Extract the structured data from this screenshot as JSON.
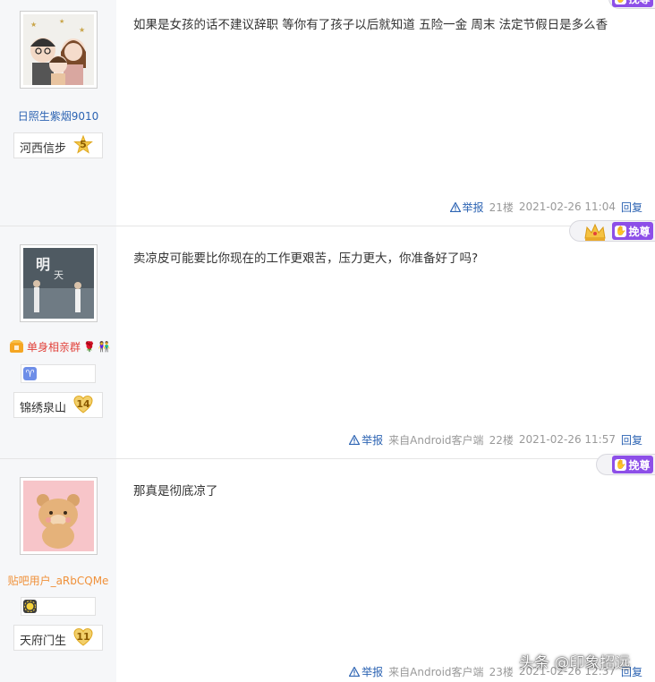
{
  "posts": [
    {
      "username": "日照生紫烟9010",
      "forum_name": "河西信步",
      "level": "5",
      "content": "如果是女孩的话不建议辞职 等你有了孩子以后就知道 五险一金 周末 法定节假日是多么香",
      "report_label": "举报",
      "floor": "21楼",
      "time": "2021-02-26 11:04",
      "reply_label": "回复",
      "respect_label": "挽尊"
    },
    {
      "username": "单身相亲群",
      "forum_name": "锦绣泉山",
      "level": "14",
      "content": "卖凉皮可能要比你现在的工作更艰苦，压力更大，你准备好了吗?",
      "report_label": "举报",
      "client": "来自Android客户端",
      "floor": "22楼",
      "time": "2021-02-26 11:57",
      "reply_label": "回复",
      "respect_label": "挽尊",
      "constellation_icon": "♈"
    },
    {
      "username": "贴吧用户_aRbCQMe",
      "forum_name": "天府门生",
      "level": "11",
      "content": "那真是彻底凉了",
      "report_label": "举报",
      "client": "来自Android客户端",
      "floor": "23楼",
      "time": "2021-02-26 12:37",
      "reply_label": "回复",
      "respect_label": "挽尊"
    }
  ],
  "watermark": "头条 @印象招远",
  "colors": {
    "link_blue": "#2d64b3",
    "respect_purple": "#8d4fe8",
    "sidebar_bg": "#f6f7f9"
  }
}
